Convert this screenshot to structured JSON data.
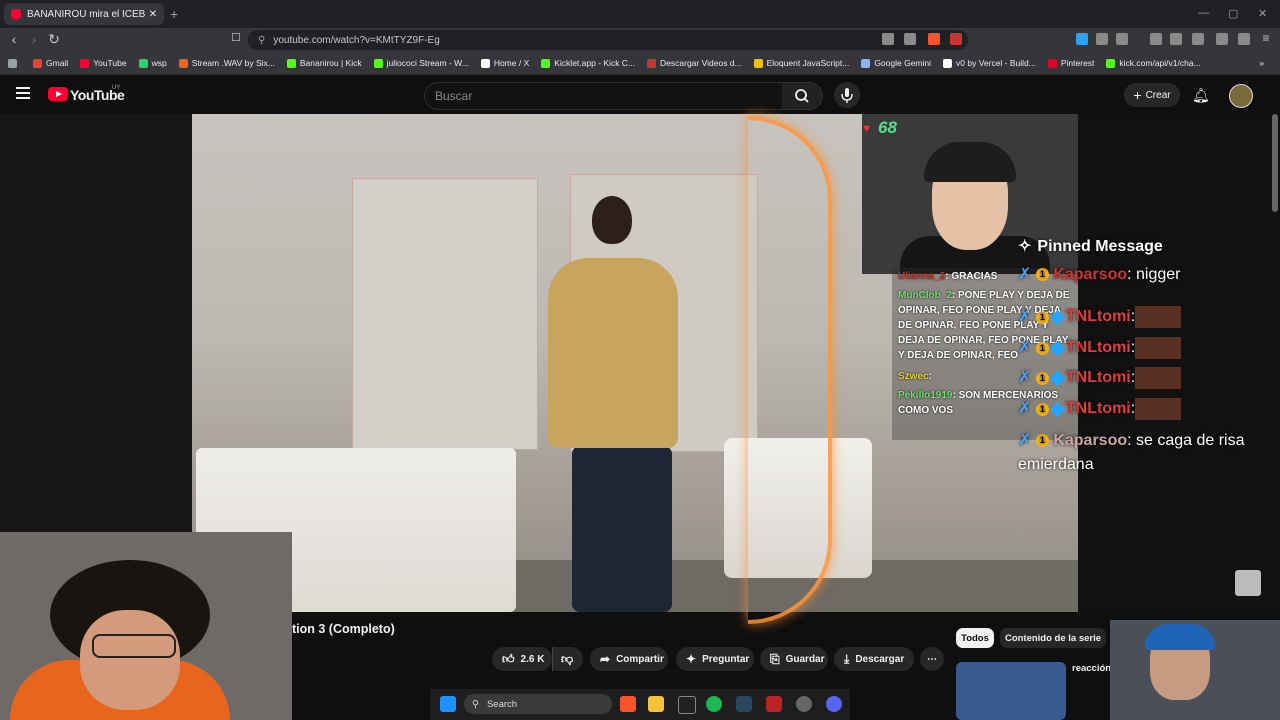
{
  "browser": {
    "tab_title": "BANANIROU mira el ICEBERG de",
    "tab_close": "✕",
    "new_tab": "+",
    "url": "youtube.com/watch?v=KMtTYZ9F-Eg",
    "bookmarks": [
      {
        "label": "Gmail",
        "color": "#ea4335"
      },
      {
        "label": "YouTube",
        "color": "#ff0033"
      },
      {
        "label": "wsp",
        "color": "#25d366"
      },
      {
        "label": "Stream .WAV by Six...",
        "color": "#e8651e"
      },
      {
        "label": "Bananirou | Kick",
        "color": "#53fc18"
      },
      {
        "label": "juliocoсi Stream - W...",
        "color": "#53fc18"
      },
      {
        "label": "Home / X",
        "color": "#ffffff"
      },
      {
        "label": "Kicklet.app - Kick C...",
        "color": "#53fc18"
      },
      {
        "label": "Descargar Videos d...",
        "color": "#c0392b"
      },
      {
        "label": "Eloquent JavaScript...",
        "color": "#f2c100"
      },
      {
        "label": "Google Gemini",
        "color": "#8ab4f8"
      },
      {
        "label": "v0 by Vercel - Build...",
        "color": "#ffffff"
      },
      {
        "label": "Pinterest",
        "color": "#e60023"
      },
      {
        "label": "kick.com/api/v1/cha...",
        "color": "#53fc18"
      }
    ]
  },
  "youtube": {
    "logo_text": "YouTube",
    "country": "UY",
    "search_placeholder": "Buscar",
    "create_label": "Crear"
  },
  "overlay": {
    "viewer_count": "68",
    "chat": [
      {
        "user": "Ulianna_2",
        "text": ": GRACIAS"
      },
      {
        "user": "MunClob_2",
        "text": ": PONE PLAY Y DEJA DE OPINAR, FEO PONE PLAY Y DEJA DE OPINAR, FEO PONE PLAY Y DEJA DE OPINAR, FEO PONE PLAY Y DEJA DE OPINAR, FEO"
      },
      {
        "user": "Szwec",
        "text": ":"
      },
      {
        "user": "Pekillo1919",
        "text": ": SON MERCENARIOS COMO VOS"
      }
    ],
    "pinned_title": "Pinned Message",
    "pinned_user": "Kaparsoo",
    "pinned_text": ": nigger",
    "spam_user": "TNLtomi",
    "spam_sep": ":",
    "last_user": "Kaparsoo",
    "last_text": ": se caga de risa emierdana"
  },
  "video": {
    "title": "tion 3 (Completo)",
    "actions": {
      "likes": "2.6 K",
      "share": "Compartir",
      "ask": "Preguntar",
      "save": "Guardar",
      "download": "Descargar",
      "more": "⋯"
    },
    "filters": [
      "Todos",
      "Contenido de la serie"
    ],
    "recommendation_label": "reacción"
  },
  "taskbar": {
    "search_label": "Search"
  }
}
